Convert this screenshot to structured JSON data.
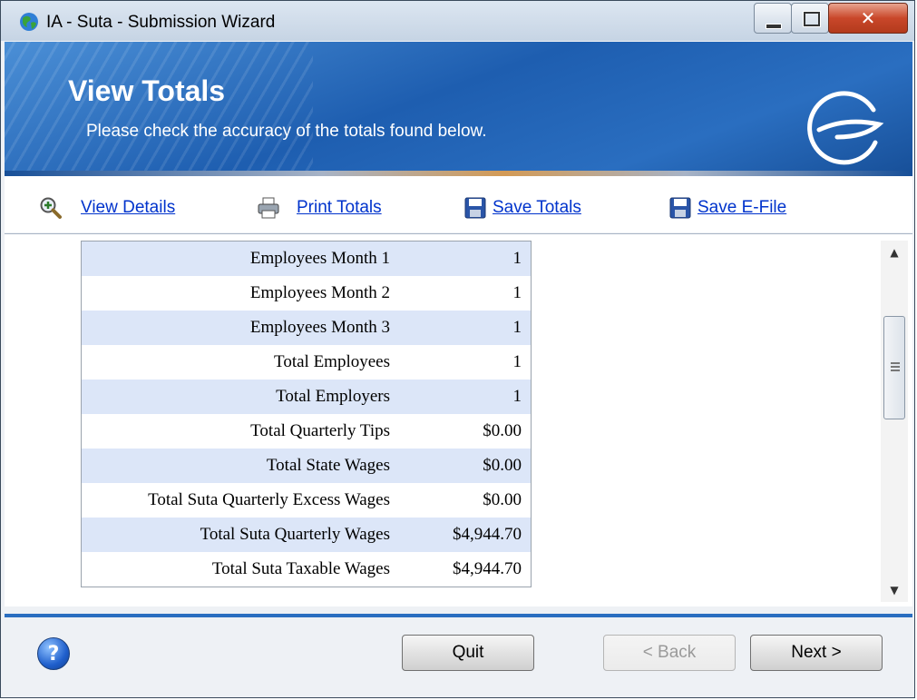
{
  "window": {
    "title": "IA - Suta - Submission Wizard"
  },
  "banner": {
    "title": "View Totals",
    "subtitle": "Please check the accuracy of the totals found below."
  },
  "toolbar": {
    "view_details": "View Details",
    "print_totals": "Print Totals",
    "save_totals": "Save Totals",
    "save_efile": "Save E-File"
  },
  "totals": [
    {
      "label": "Employees Month 1",
      "value": "1"
    },
    {
      "label": "Employees Month 2",
      "value": "1"
    },
    {
      "label": "Employees Month 3",
      "value": "1"
    },
    {
      "label": "Total Employees",
      "value": "1"
    },
    {
      "label": "Total Employers",
      "value": "1"
    },
    {
      "label": "Total Quarterly Tips",
      "value": "$0.00"
    },
    {
      "label": "Total State Wages",
      "value": "$0.00"
    },
    {
      "label": "Total Suta Quarterly Excess Wages",
      "value": "$0.00"
    },
    {
      "label": "Total Suta Quarterly Wages",
      "value": "$4,944.70"
    },
    {
      "label": "Total Suta Taxable Wages",
      "value": "$4,944.70"
    }
  ],
  "footer": {
    "quit": "Quit",
    "back": "< Back",
    "next": "Next >"
  }
}
